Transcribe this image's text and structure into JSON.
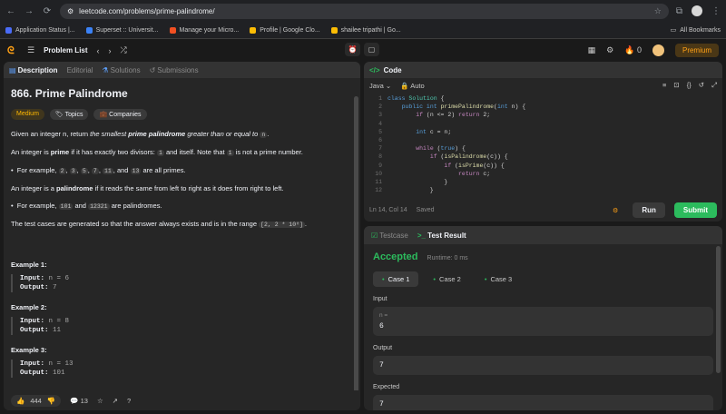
{
  "browser": {
    "url": "leetcode.com/problems/prime-palindrome/",
    "bookmarks": [
      "Application Status |...",
      "Superset :: Universit...",
      "Manage your Micro...",
      "Profile | Google Clo...",
      "shailee tripathi | Go..."
    ],
    "all_bookmarks": "All Bookmarks"
  },
  "nav": {
    "problem_list": "Problem List",
    "streak": "0",
    "premium": "Premium"
  },
  "left_tabs": [
    "Description",
    "Editorial",
    "Solutions",
    "Submissions"
  ],
  "problem": {
    "title": "866. Prime Palindrome",
    "difficulty": "Medium",
    "topics": "Topics",
    "companies": "Companies",
    "p1_a": "Given an integer n, return",
    "p1_b": "the smallest",
    "p1_c": "prime palindrome",
    "p1_d": "greater than or equal to",
    "p1_code": "n",
    "p2_a": "An integer is",
    "p2_b": "prime",
    "p2_c": "if it has exactly two divisors:",
    "p2_code1": "1",
    "p2_d": "and itself. Note that",
    "p2_code2": "1",
    "p2_e": "is not a prime number.",
    "b1_a": "For example,",
    "b1_codes": [
      "2",
      "3",
      "5",
      "7",
      "11"
    ],
    "b1_and": "and",
    "b1_code_last": "13",
    "b1_b": "are all primes.",
    "p3_a": "An integer is a",
    "p3_b": "palindrome",
    "p3_c": "if it reads the same from left to right as it does from right to left.",
    "b2_a": "For example,",
    "b2_code1": "101",
    "b2_and": "and",
    "b2_code2": "12321",
    "b2_b": "are palindromes.",
    "p4_a": "The test cases are generated so that the answer always exists and is in the range",
    "p4_code": "[2, 2 * 10⁸]",
    "examples": [
      {
        "title": "Example 1:",
        "input": "n = 6",
        "output": "7"
      },
      {
        "title": "Example 2:",
        "input": "n = 8",
        "output": "11"
      },
      {
        "title": "Example 3:",
        "input": "n = 13",
        "output": "101"
      }
    ],
    "input_label": "Input:",
    "output_label": "Output:",
    "likes": "444",
    "comments": "13"
  },
  "editor": {
    "header": "Code",
    "language": "Java",
    "mode": "Auto",
    "line_numbers": [
      "1",
      "2",
      "3",
      "4",
      "5",
      "6",
      "7",
      "8",
      "9",
      "10",
      "11",
      "12"
    ],
    "status": "Ln 14, Col 14",
    "saved": "Saved",
    "run": "Run",
    "submit": "Submit"
  },
  "result": {
    "tab_testcase": "Testcase",
    "tab_result": "Test Result",
    "verdict": "Accepted",
    "runtime": "Runtime: 0 ms",
    "cases": [
      "Case 1",
      "Case 2",
      "Case 3"
    ],
    "input_label": "Input",
    "input_var": "n =",
    "input_value": "6",
    "output_label": "Output",
    "output_value": "7",
    "expected_label": "Expected",
    "expected_value": "7"
  }
}
